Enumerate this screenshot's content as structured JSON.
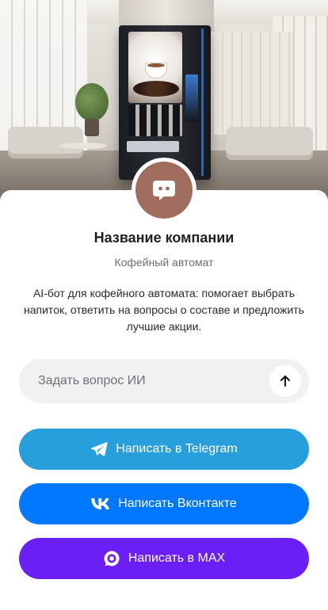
{
  "hero": {
    "icon": "vending-machine-photo"
  },
  "company": {
    "name": "Название компании",
    "type": "Кофейный автомат",
    "description": "AI-бот для кофейного автомата: помогает выбрать напиток, ответить на вопросы о составе и предложить лучшие акции.",
    "avatar_icon": "chat-bubble-icon",
    "avatar_color": "#a06d5e"
  },
  "ask": {
    "placeholder": "Задать вопрос ИИ",
    "value": "",
    "send_icon": "arrow-up-icon"
  },
  "buttons": {
    "telegram": {
      "label": "Написать в Telegram",
      "icon": "telegram-icon",
      "color": "#279fdc"
    },
    "vk": {
      "label": "Написать Вконтакте",
      "icon": "vk-icon",
      "color": "#0077ff"
    },
    "max": {
      "label": "Написать в MAX",
      "icon": "max-icon",
      "color": "#6b1ff5"
    }
  }
}
